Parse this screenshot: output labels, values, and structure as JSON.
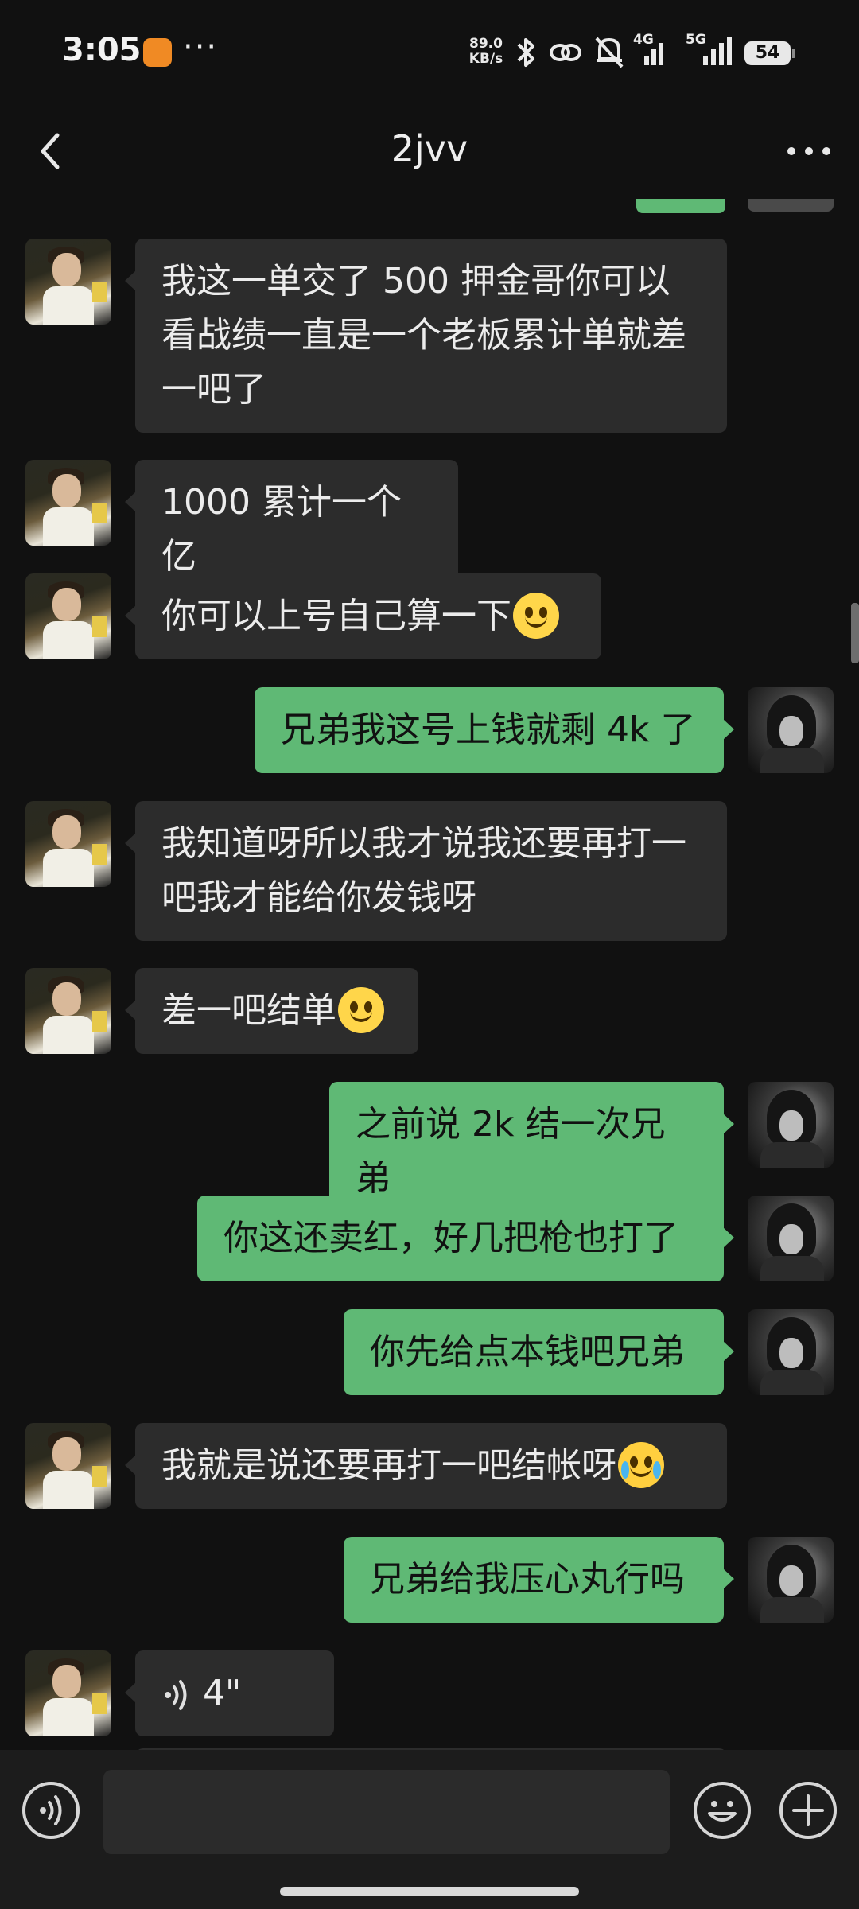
{
  "status_bar": {
    "time": "3:05",
    "app_badge_color": "#f08a24",
    "dots": "···",
    "net_speed_value": "89.0",
    "net_speed_unit": "KB/s",
    "icons": [
      "bluetooth-icon",
      "link-icon",
      "mute-bell-icon"
    ],
    "signal1_label": "4G",
    "signal2_label": "5G",
    "battery": "54"
  },
  "header": {
    "back_icon": "chevron-left-icon",
    "title": "2jvv",
    "more_icon": "more-dots-icon"
  },
  "messages": [
    {
      "side": "left",
      "text": "我这一单交了 500 押金哥你可以看战绩一直是一个老板累计单就差一吧了"
    },
    {
      "side": "left",
      "text": "1000 累计一个亿"
    },
    {
      "side": "left",
      "text": "你可以上号自己算一下",
      "emoji": "smile-emoji"
    },
    {
      "side": "right",
      "text": "兄弟我这号上钱就剩 4k 了"
    },
    {
      "side": "left",
      "text": "我知道呀所以我才说我还要再打一吧我才能给你发钱呀"
    },
    {
      "side": "left",
      "text": "差一吧结单",
      "emoji": "smile-emoji"
    },
    {
      "side": "right",
      "text": "之前说 2k 结一次兄弟"
    },
    {
      "side": "right",
      "text": "你这还卖红，好几把枪也打了"
    },
    {
      "side": "right",
      "text": "你先给点本钱吧兄弟"
    },
    {
      "side": "left",
      "text": "我就是说还要再打一吧结帐呀",
      "emoji": "laugh-cry-emoji"
    },
    {
      "side": "right",
      "text": "兄弟给我压心丸行吗"
    },
    {
      "side": "left",
      "voice": true,
      "duration": "4\""
    }
  ],
  "colors": {
    "background": "#111111",
    "sent_bubble": "#5fb975",
    "received_bubble": "#2c2c2c"
  },
  "input_bar": {
    "voice_icon": "voice-mode-icon",
    "emoji_icon": "emoji-icon",
    "plus_icon": "plus-icon",
    "text_value": ""
  }
}
